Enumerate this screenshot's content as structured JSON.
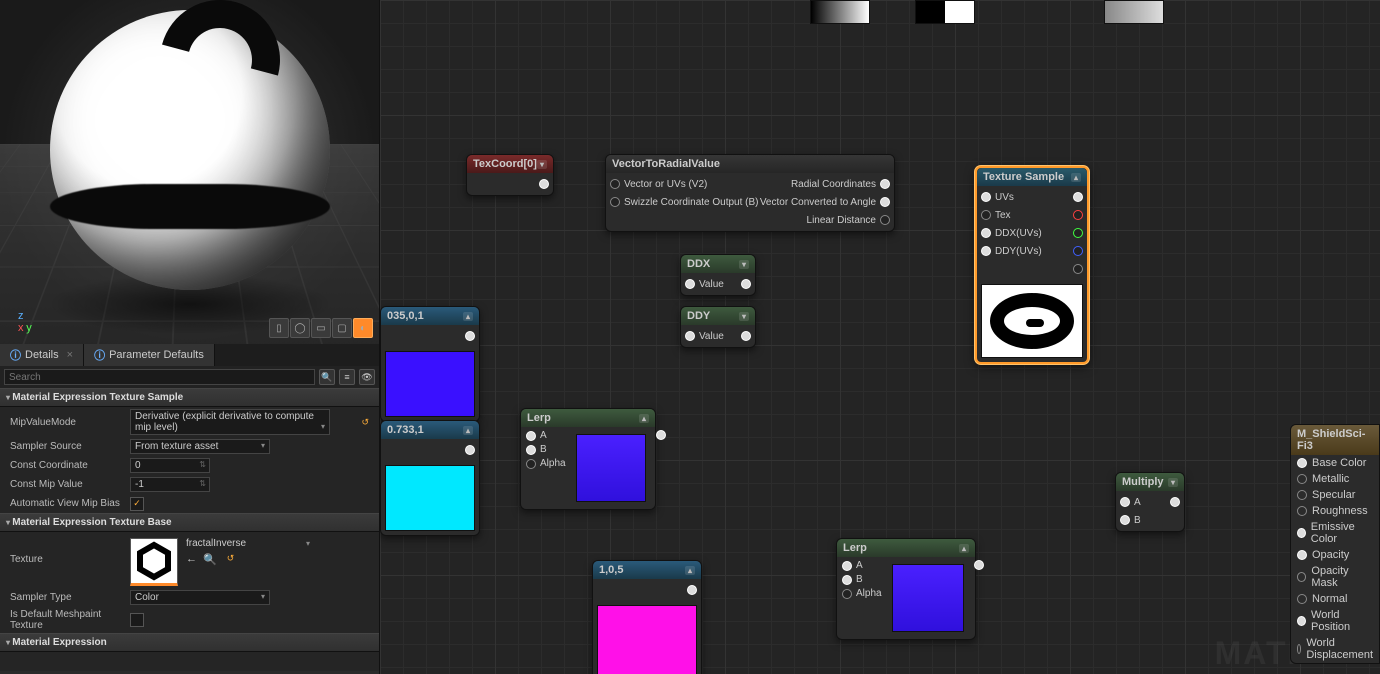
{
  "tabs": {
    "details": "Details",
    "paramDefaults": "Parameter Defaults"
  },
  "search": {
    "placeholder": "Search"
  },
  "sections": {
    "texSample": {
      "title": "Material Expression Texture Sample",
      "mipValueMode": {
        "label": "MipValueMode",
        "value": "Derivative (explicit derivative to compute mip level)"
      },
      "samplerSource": {
        "label": "Sampler Source",
        "value": "From texture asset"
      },
      "constCoord": {
        "label": "Const Coordinate",
        "value": "0"
      },
      "constMip": {
        "label": "Const Mip Value",
        "value": "-1"
      },
      "autoViewMipBias": {
        "label": "Automatic View Mip Bias",
        "checked": true
      }
    },
    "texBase": {
      "title": "Material Expression Texture Base",
      "texture": {
        "label": "Texture",
        "asset": "fractalInverse"
      },
      "samplerType": {
        "label": "Sampler Type",
        "value": "Color"
      },
      "defaultMeshpaint": {
        "label": "Is Default Meshpaint Texture",
        "checked": false
      }
    },
    "matExpr": {
      "title": "Material Expression"
    }
  },
  "nodes": {
    "texcoord": {
      "title": "TexCoord[0]"
    },
    "v2r": {
      "title": "VectorToRadialValue",
      "in1": "Vector or UVs (V2)",
      "in2": "Swizzle Coordinate Output (B)",
      "out1": "Radial Coordinates",
      "out2": "Vector Converted to Angle",
      "out3": "Linear Distance"
    },
    "ddx": {
      "title": "DDX",
      "pin": "Value"
    },
    "ddy": {
      "title": "DDY",
      "pin": "Value"
    },
    "texsample": {
      "title": "Texture Sample",
      "uvs": "UVs",
      "tex": "Tex",
      "ddxu": "DDX(UVs)",
      "ddyu": "DDY(UVs)"
    },
    "const1": {
      "title": "035,0,1"
    },
    "const2": {
      "title": "0.733,1"
    },
    "const3": {
      "title": "1,0,5"
    },
    "lerp1": {
      "title": "Lerp",
      "a": "A",
      "b": "B",
      "alpha": "Alpha"
    },
    "lerp2": {
      "title": "Lerp",
      "a": "A",
      "b": "B",
      "alpha": "Alpha"
    },
    "mult": {
      "title": "Multiply",
      "a": "A",
      "b": "B"
    }
  },
  "material": {
    "title": "M_ShieldSci-Fi3",
    "pins": [
      "Base Color",
      "Metallic",
      "Specular",
      "Roughness",
      "Emissive Color",
      "Opacity",
      "Opacity Mask",
      "Normal",
      "World Position",
      "World Displacement"
    ]
  },
  "watermark": "MATERIA"
}
